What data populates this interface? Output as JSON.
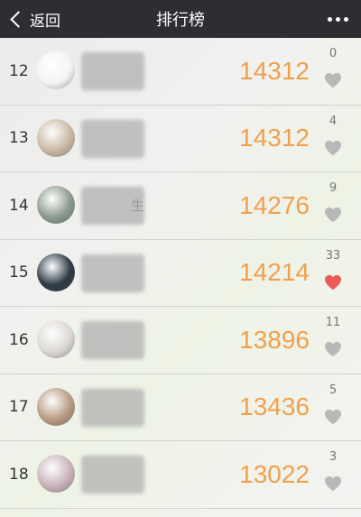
{
  "navbar": {
    "back_label": "返回",
    "title": "排行榜"
  },
  "rows": [
    {
      "rank": "12",
      "score": "14312",
      "likes": "0",
      "liked": false,
      "avatar_color": "#f4f4f4",
      "name_tail": ""
    },
    {
      "rank": "13",
      "score": "14312",
      "likes": "4",
      "liked": false,
      "avatar_color": "#c9b9a3",
      "name_tail": ""
    },
    {
      "rank": "14",
      "score": "14276",
      "likes": "9",
      "liked": false,
      "avatar_color": "#8a9a8d",
      "name_tail": "生"
    },
    {
      "rank": "15",
      "score": "14214",
      "likes": "33",
      "liked": true,
      "avatar_color": "#2d3a44",
      "name_tail": ""
    },
    {
      "rank": "16",
      "score": "13896",
      "likes": "11",
      "liked": false,
      "avatar_color": "#dcd8d3",
      "name_tail": ""
    },
    {
      "rank": "17",
      "score": "13436",
      "likes": "5",
      "liked": false,
      "avatar_color": "#b79a82",
      "name_tail": ""
    },
    {
      "rank": "18",
      "score": "13022",
      "likes": "3",
      "liked": false,
      "avatar_color": "#c8b3b9",
      "name_tail": ""
    }
  ],
  "colors": {
    "score": "#f0a04b",
    "heart_liked": "#ee5b5b",
    "heart_default": "#b8b8b8",
    "navbar": "#2d2d32"
  }
}
